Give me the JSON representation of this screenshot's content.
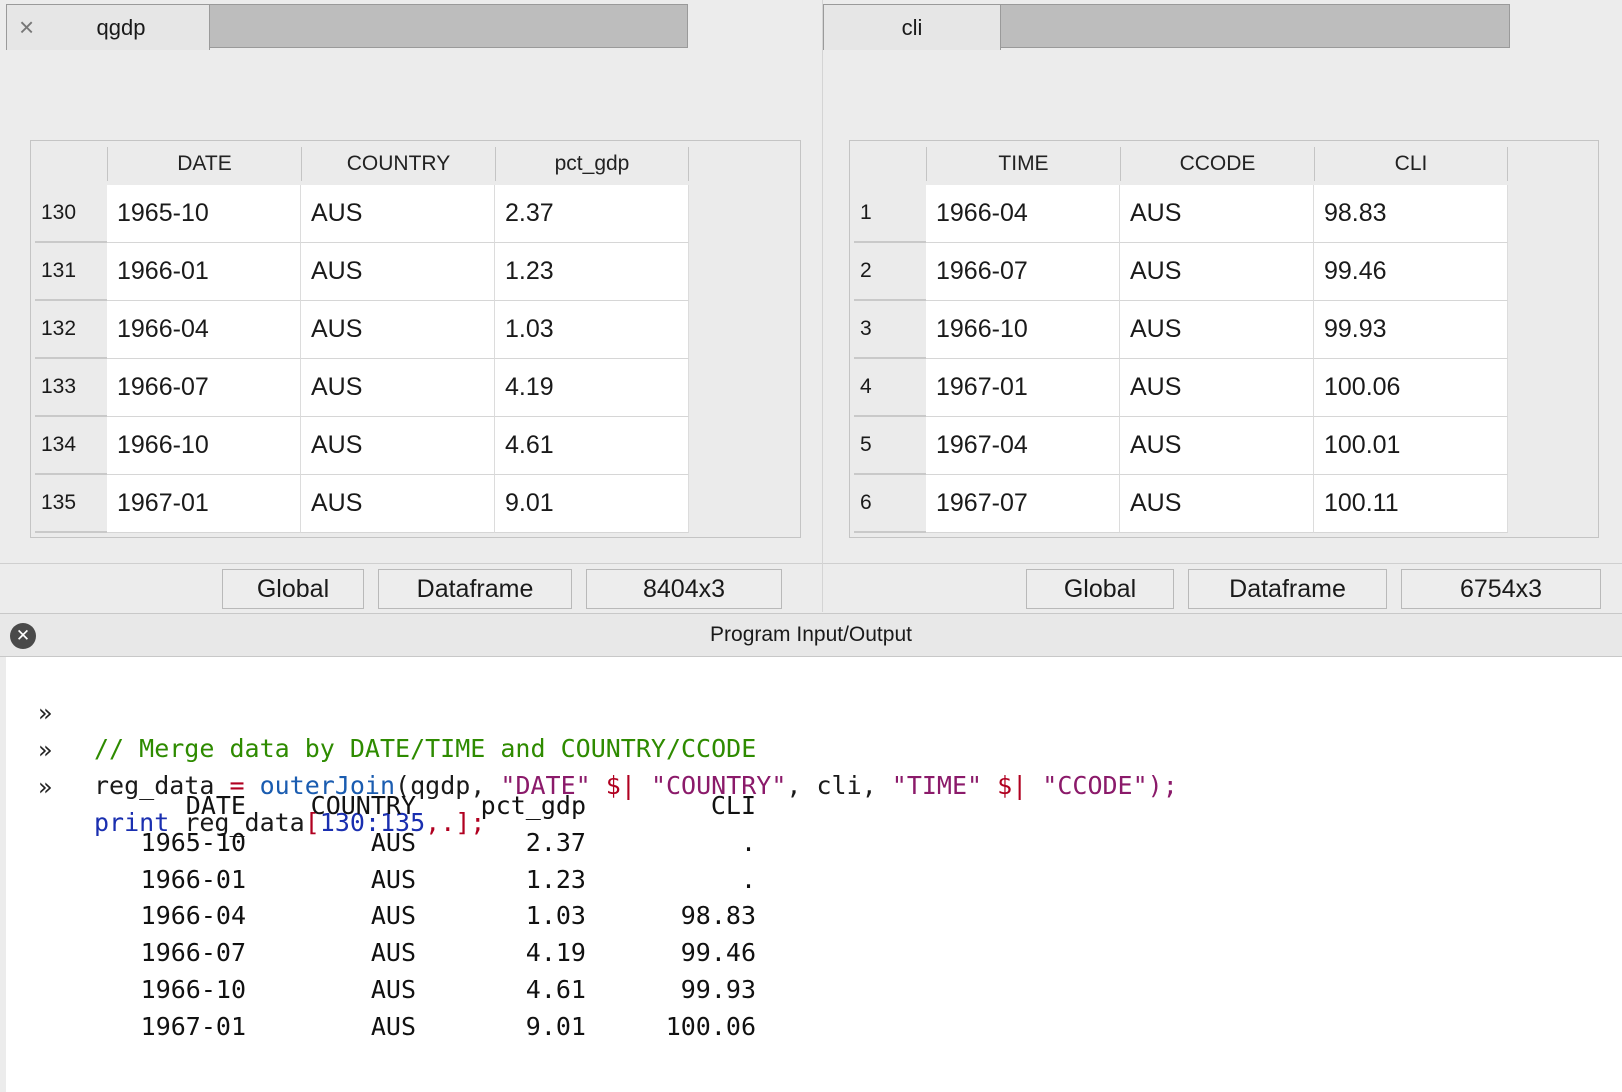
{
  "left_panel": {
    "tab_label": "qgdp",
    "columns": [
      "DATE",
      "COUNTRY",
      "pct_gdp"
    ],
    "rows": [
      {
        "num": "130",
        "cells": [
          "1965-10",
          "AUS",
          "2.37"
        ]
      },
      {
        "num": "131",
        "cells": [
          "1966-01",
          "AUS",
          "1.23"
        ]
      },
      {
        "num": "132",
        "cells": [
          "1966-04",
          "AUS",
          "1.03"
        ]
      },
      {
        "num": "133",
        "cells": [
          "1966-07",
          "AUS",
          "4.19"
        ]
      },
      {
        "num": "134",
        "cells": [
          "1966-10",
          "AUS",
          "4.61"
        ]
      },
      {
        "num": "135",
        "cells": [
          "1967-01",
          "AUS",
          "9.01"
        ]
      }
    ],
    "status": {
      "scope": "Global",
      "type": "Dataframe",
      "dims": "8404x3"
    }
  },
  "right_panel": {
    "tab_label": "cli",
    "columns": [
      "TIME",
      "CCODE",
      "CLI"
    ],
    "rows": [
      {
        "num": "1",
        "cells": [
          "1966-04",
          "AUS",
          "98.83"
        ]
      },
      {
        "num": "2",
        "cells": [
          "1966-07",
          "AUS",
          "99.46"
        ]
      },
      {
        "num": "3",
        "cells": [
          "1966-10",
          "AUS",
          "99.93"
        ]
      },
      {
        "num": "4",
        "cells": [
          "1967-01",
          "AUS",
          "100.06"
        ]
      },
      {
        "num": "5",
        "cells": [
          "1967-04",
          "AUS",
          "100.01"
        ]
      },
      {
        "num": "6",
        "cells": [
          "1967-07",
          "AUS",
          "100.11"
        ]
      }
    ],
    "status": {
      "scope": "Global",
      "type": "Dataframe",
      "dims": "6754x3"
    }
  },
  "io_panel": {
    "title": "Program Input/Output",
    "prompt_symbol": "»",
    "commands": {
      "line1": "// Merge data by DATE/TIME and COUNTRY/CCODE",
      "line2": {
        "var": "reg_data",
        "assign": " = ",
        "func": "outerJoin",
        "open": "(qgdp, ",
        "s1": "\"DATE\"",
        "op1": " $| ",
        "s2": "\"COUNTRY\"",
        "mid": ", cli, ",
        "s3": "\"TIME\"",
        "op2": " $| ",
        "s4": "\"CCODE\"",
        "close": ");"
      },
      "line3": {
        "kw": "print",
        "var": " reg_data",
        "idx_open": "[",
        "range": "130:135",
        "idx_rest": ",.];"
      }
    },
    "output": {
      "headers": [
        "DATE",
        "COUNTRY",
        "pct_gdp",
        "CLI"
      ],
      "rows": [
        [
          "1965-10",
          "AUS",
          "2.37",
          "."
        ],
        [
          "1966-01",
          "AUS",
          "1.23",
          "."
        ],
        [
          "1966-04",
          "AUS",
          "1.03",
          "98.83"
        ],
        [
          "1966-07",
          "AUS",
          "4.19",
          "99.46"
        ],
        [
          "1966-10",
          "AUS",
          "4.61",
          "99.93"
        ],
        [
          "1967-01",
          "AUS",
          "9.01",
          "100.06"
        ]
      ]
    }
  }
}
